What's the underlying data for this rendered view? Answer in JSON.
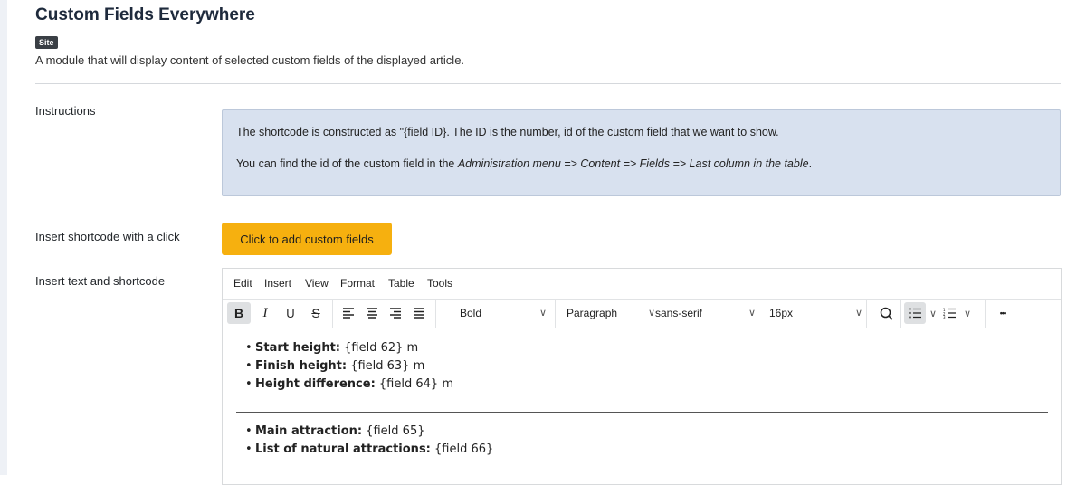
{
  "header": {
    "title": "Custom Fields Everywhere",
    "badge": "Site",
    "description": "A module that will display content of selected custom fields of the displayed article."
  },
  "instructions": {
    "label": "Instructions",
    "line1": "The shortcode is constructed as \"{field ID}. The ID is the number, id of the custom field that we want to show.",
    "line2_prefix": "You can find the id of the custom field in the ",
    "line2_italic": "Administration menu => Content => Fields => Last column in the table",
    "line2_suffix": "."
  },
  "shortcode_click": {
    "label": "Insert shortcode with a click",
    "button": "Click to add custom fields",
    "button_color": "#f6b00f"
  },
  "editor": {
    "label": "Insert text and shortcode",
    "menu": [
      "Edit",
      "Insert",
      "View",
      "Format",
      "Table",
      "Tools"
    ],
    "toolbar": {
      "bold": "B",
      "italic": "I",
      "underline": "U",
      "strike": "S",
      "block_format": "Bold",
      "paragraph": "Paragraph",
      "font_family": "sans-serif",
      "font_size": "16px",
      "more": "•••"
    },
    "list1": [
      {
        "label": "Start height:",
        "value": " {field 62} m"
      },
      {
        "label": "Finish height:",
        "value": " {field 63} m"
      },
      {
        "label": "Height difference:",
        "value": " {field 64} m"
      }
    ],
    "list2": [
      {
        "label": "Main attraction:",
        "value": " {field 65}"
      },
      {
        "label": "List of natural attractions:",
        "value": " {field 66}"
      }
    ]
  },
  "colors": {
    "info_box": "#d8e1ef",
    "accent": "#f6b00f"
  }
}
